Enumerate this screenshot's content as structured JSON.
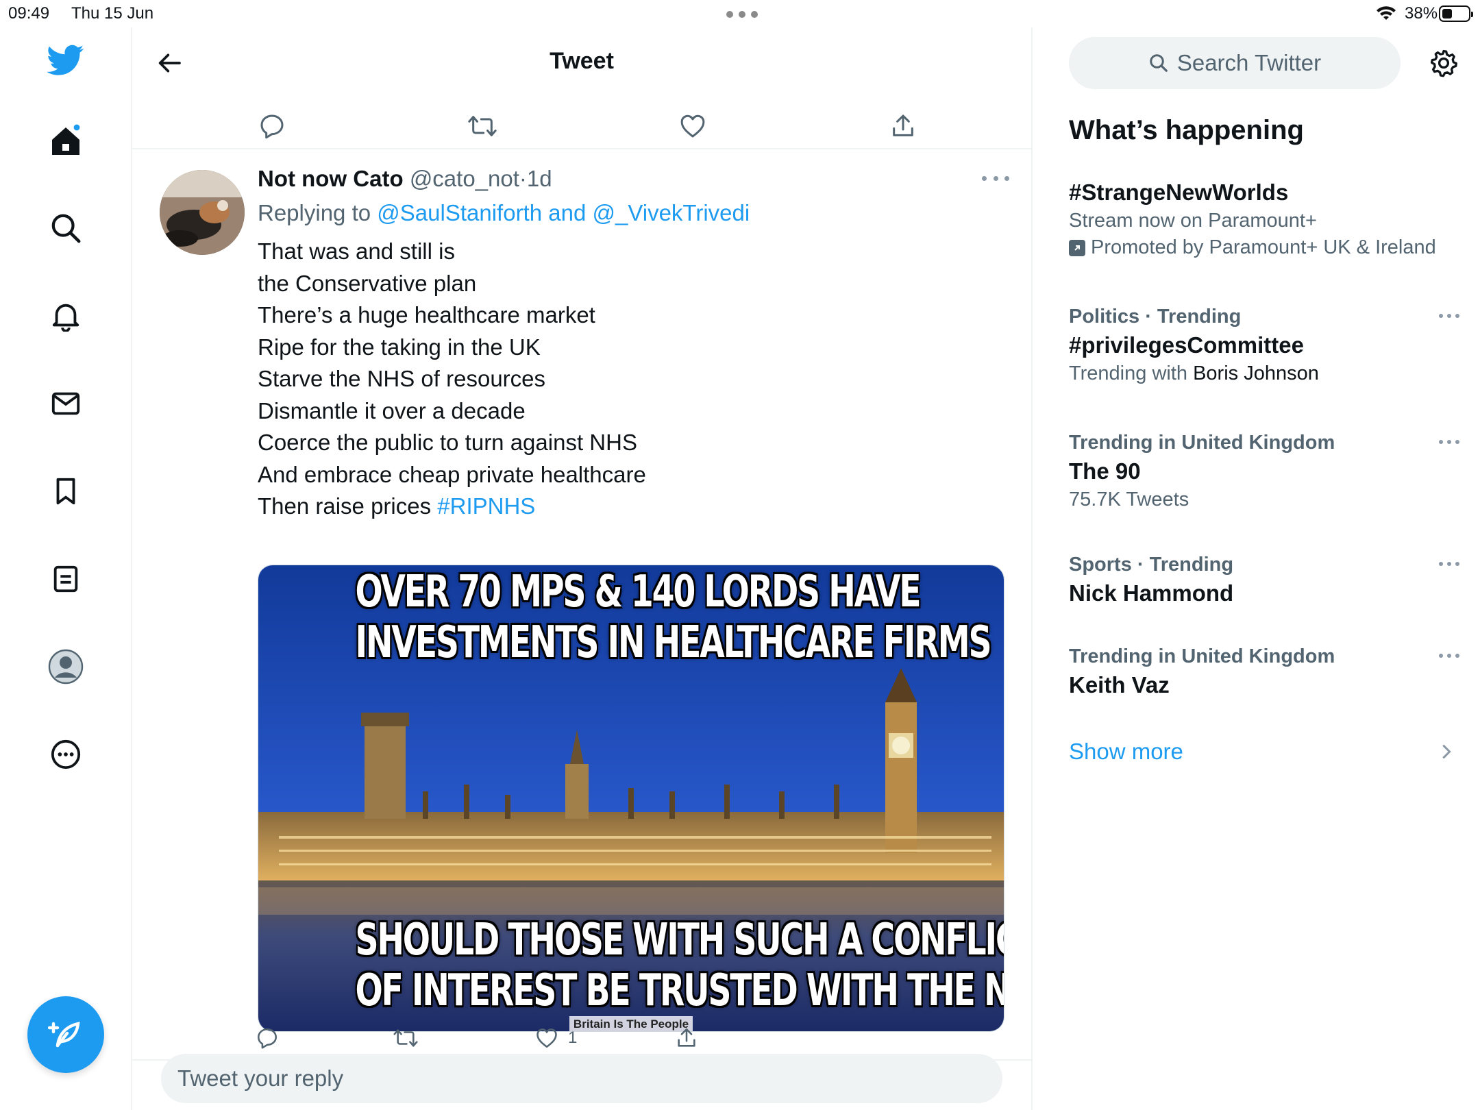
{
  "status_bar": {
    "time": "09:49",
    "date": "Thu 15 Jun",
    "battery": "38%",
    "battery_level": 0.38
  },
  "header": {
    "title": "Tweet"
  },
  "nav": {
    "items": [
      "home",
      "explore",
      "notifications",
      "messages",
      "bookmarks",
      "lists",
      "profile",
      "more"
    ],
    "home_has_notification": true
  },
  "tweet": {
    "author_name": "Not now Cato",
    "handle": "@cato_not",
    "separator": "·",
    "time": "1d",
    "replying_prefix": "Replying to",
    "replying_users": "@SaulStaniforth and @_VivekTrivedi",
    "lines": [
      "That was and still is",
      "the Conservative plan",
      "There’s a huge healthcare market",
      "Ripe for the taking in the UK",
      "Starve the NHS of resources",
      "Dismantle it over a decade",
      "Coerce the public to turn against NHS",
      "And embrace cheap private healthcare",
      "Then raise prices"
    ],
    "hashtag": "#RIPNHS",
    "image": {
      "top_line1": "OVER 70 MPS & 140 LORDS HAVE",
      "top_line2": "INVESTMENTS IN HEALTHCARE FIRMS",
      "bottom_line1": "SHOULD THOSE WITH SUCH A CONFLICT",
      "bottom_line2": "OF INTEREST BE TRUSTED WITH THE NHS?",
      "watermark": "Britain Is The People"
    },
    "like_count": "1"
  },
  "reply": {
    "placeholder": "Tweet your reply"
  },
  "sidebar": {
    "search_placeholder": "Search Twitter",
    "section_title": "What’s happening",
    "promoted": {
      "title": "#StrangeNewWorlds",
      "subtitle": "Stream now on Paramount+",
      "promoted_by": "Promoted by Paramount+ UK & Ireland"
    },
    "trends": [
      {
        "meta": "Politics · Trending",
        "title": "#privilegesCommittee",
        "sub_prefix": "Trending with",
        "sub_strong": "Boris Johnson"
      },
      {
        "meta": "Trending in United Kingdom",
        "title": "The 90",
        "sub_prefix": "75.7K Tweets",
        "sub_strong": ""
      },
      {
        "meta": "Sports · Trending",
        "title": "Nick Hammond",
        "sub_prefix": "",
        "sub_strong": ""
      },
      {
        "meta": "Trending in United Kingdom",
        "title": "Keith Vaz",
        "sub_prefix": "",
        "sub_strong": ""
      }
    ],
    "show_more": "Show more"
  },
  "colors": {
    "accent": "#1d9bf0",
    "text": "#0f1419",
    "muted": "#536471",
    "divider": "#eff3f4"
  }
}
